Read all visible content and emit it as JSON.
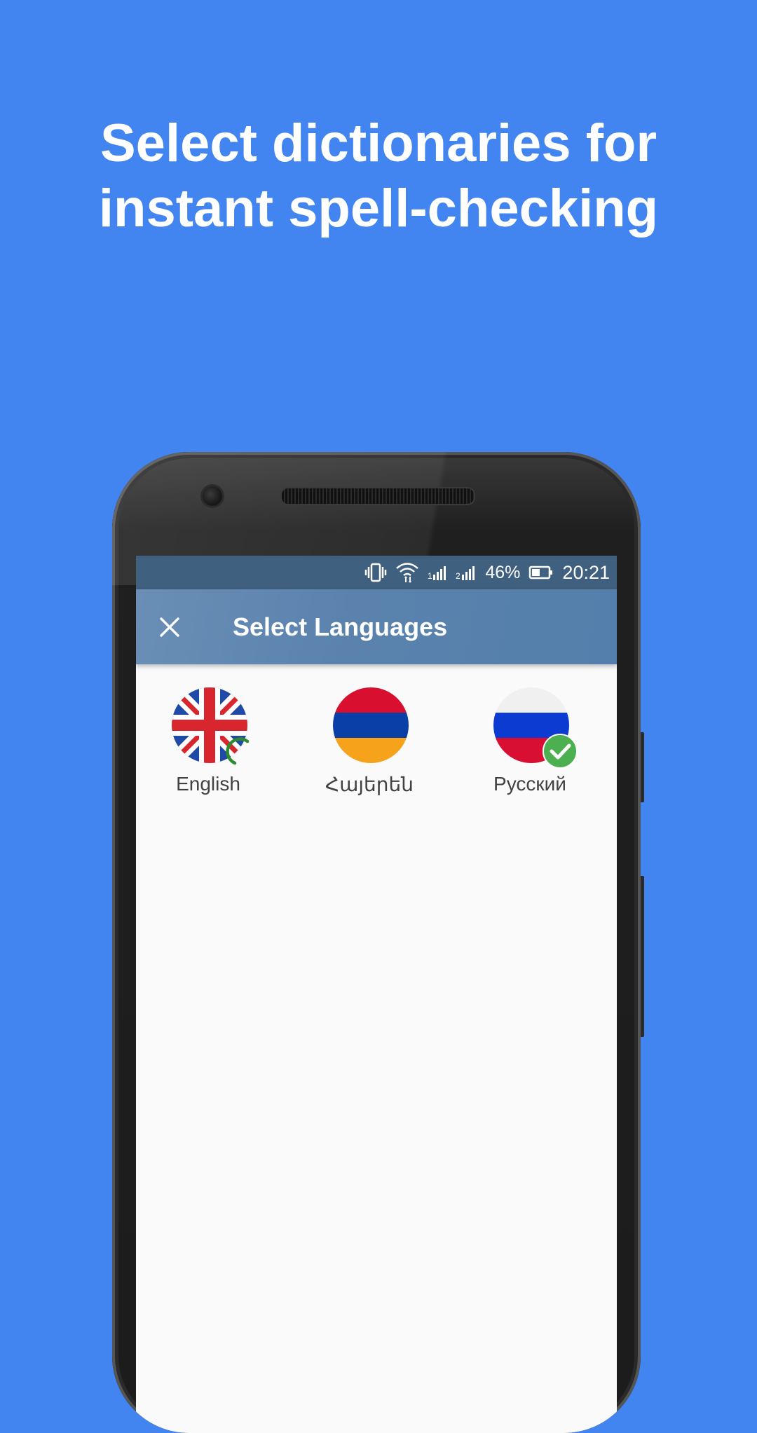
{
  "headline": {
    "line1": "Select dictionaries for",
    "line2": "instant spell-checking"
  },
  "status_bar": {
    "battery": "46%",
    "time": "20:21",
    "icons": [
      "vibrate-icon",
      "wifi-icon",
      "signal-1-icon",
      "signal-2-icon",
      "battery-icon"
    ]
  },
  "app_bar": {
    "close_icon": "close-icon",
    "title": "Select Languages"
  },
  "languages": [
    {
      "label": "English",
      "flag": "uk-flag-icon",
      "state": "downloading"
    },
    {
      "label": "Հայերեն",
      "flag": "armenia-flag-icon",
      "state": "none"
    },
    {
      "label": "Русский",
      "flag": "russia-flag-icon",
      "state": "selected"
    }
  ],
  "colors": {
    "background": "#4285f1",
    "app_bar": "#5a82ad",
    "status_bar": "#40607f",
    "check_green": "#4caf50",
    "progress_green": "#2e8b30"
  }
}
